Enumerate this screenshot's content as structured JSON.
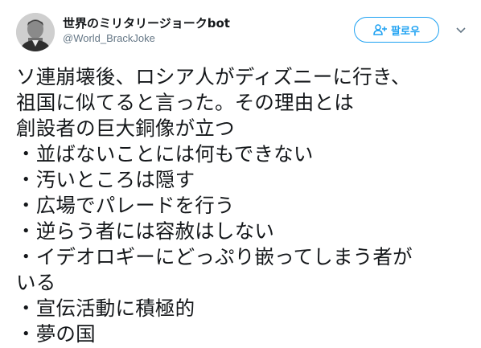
{
  "account": {
    "display_name": "世界のミリタリージョークbot",
    "handle": "@World_BrackJoke"
  },
  "follow_button": {
    "label": "팔로우",
    "icon": "add-user-icon"
  },
  "menu": {
    "icon": "chevron-down-icon"
  },
  "colors": {
    "accent": "#1da1f2",
    "text": "#14171a",
    "secondary": "#657786"
  },
  "tweet": {
    "lines": [
      "ソ連崩壊後、ロシア人がディズニーに行き、",
      "祖国に似てると言った。その理由とは",
      "創設者の巨大銅像が立つ",
      "・並ばないことには何もできない",
      "・汚いところは隠す",
      "・広場でパレードを行う",
      "・逆らう者には容赦はしない",
      "・イデオロギーにどっぷり嵌ってしまう者が",
      "いる",
      "・宣伝活動に積極的",
      "・夢の国"
    ]
  }
}
